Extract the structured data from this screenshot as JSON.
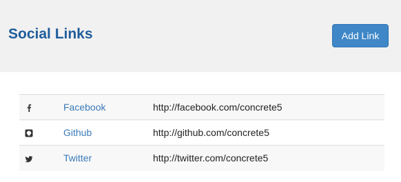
{
  "header": {
    "title": "Social Links",
    "add_button_label": "Add Link"
  },
  "links": [
    {
      "icon": "facebook-icon",
      "name": "Facebook",
      "url": "http://facebook.com/concrete5"
    },
    {
      "icon": "github-icon",
      "name": "Github",
      "url": "http://github.com/concrete5"
    },
    {
      "icon": "twitter-icon",
      "name": "Twitter",
      "url": "http://twitter.com/concrete5"
    }
  ],
  "colors": {
    "title": "#1f5d9b",
    "button": "#3f87c7",
    "link": "#3a7ab8",
    "header_bg": "#f1f1f1"
  }
}
